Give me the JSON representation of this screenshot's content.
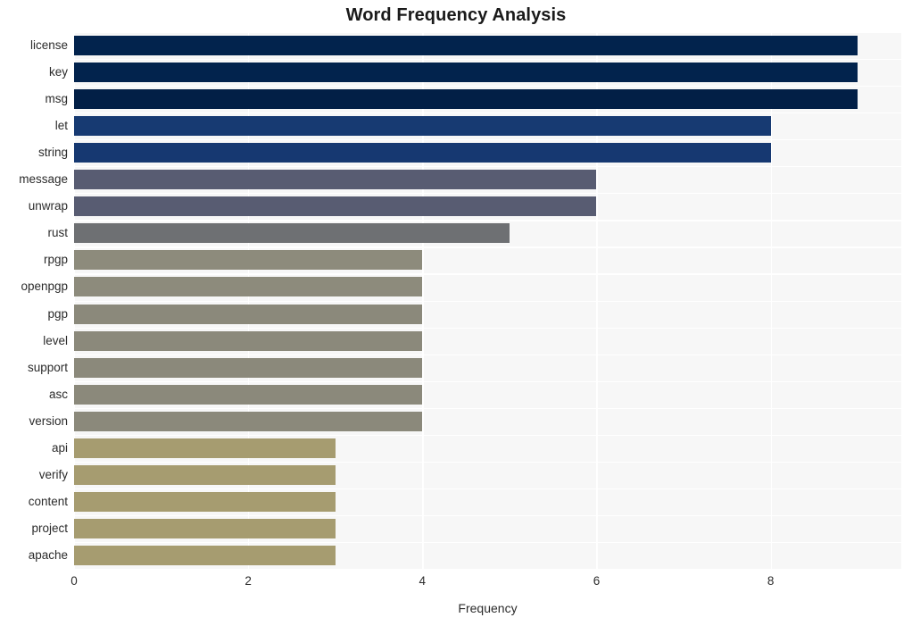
{
  "chart_data": {
    "type": "bar",
    "orientation": "horizontal",
    "title": "Word Frequency Analysis",
    "xlabel": "Frequency",
    "ylabel": "",
    "categories": [
      "license",
      "key",
      "msg",
      "let",
      "string",
      "message",
      "unwrap",
      "rust",
      "rpgp",
      "openpgp",
      "pgp",
      "level",
      "support",
      "asc",
      "version",
      "api",
      "verify",
      "content",
      "project",
      "apache"
    ],
    "values": [
      9,
      9,
      9,
      8,
      8,
      6,
      6,
      5,
      4,
      4,
      4,
      4,
      4,
      4,
      4,
      3,
      3,
      3,
      3,
      3
    ],
    "bar_colors": [
      "#02234d",
      "#02234d",
      "#021f46",
      "#173a72",
      "#163871",
      "#585c72",
      "#585c72",
      "#6e7073",
      "#8d8b7c",
      "#8d8b7c",
      "#8b897b",
      "#8b897b",
      "#8b897b",
      "#8b897b",
      "#8b897b",
      "#a69c70",
      "#a69c70",
      "#a69c70",
      "#a69c70",
      "#a69c70"
    ],
    "xlim": [
      0,
      9.5
    ],
    "xticks": [
      0,
      2,
      4,
      6,
      8
    ],
    "xtick_labels": [
      "0",
      "2",
      "4",
      "6",
      "8"
    ],
    "grid": true,
    "grid_color": "#ffffff",
    "plot_background": "#f7f7f7",
    "figure_background": "#ffffff",
    "legend": null
  }
}
